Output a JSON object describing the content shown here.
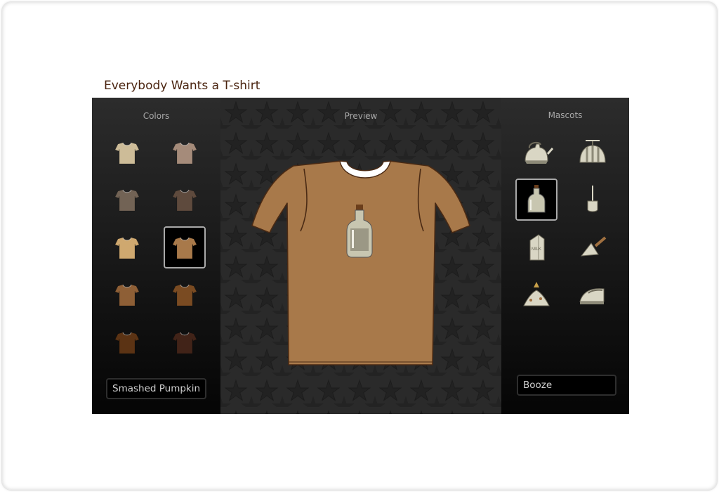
{
  "app": {
    "title": "Everybody Wants a T-shirt"
  },
  "colors_panel": {
    "heading": "Colors",
    "selected_name": "Smashed Pumpkin",
    "swatches": [
      {
        "color": "#cdbc98",
        "selected": false
      },
      {
        "color": "#a58b7a",
        "selected": false
      },
      {
        "color": "#726355",
        "selected": false
      },
      {
        "color": "#5e4a3d",
        "selected": false
      },
      {
        "color": "#cfa86f",
        "selected": false
      },
      {
        "color": "#a8794a",
        "selected": true
      },
      {
        "color": "#8e5f36",
        "selected": false
      },
      {
        "color": "#7a4b22",
        "selected": false
      },
      {
        "color": "#5b3314",
        "selected": false
      },
      {
        "color": "#412318",
        "selected": false
      }
    ]
  },
  "preview_panel": {
    "heading": "Preview",
    "shirt_color": "#a8794a",
    "collar_color": "#ffffff",
    "mascot": "bottle-icon"
  },
  "mascots_panel": {
    "heading": "Mascots",
    "selected_name": "Booze",
    "items": [
      {
        "icon": "kettle-icon",
        "selected": false
      },
      {
        "icon": "propeller-cap-icon",
        "selected": false
      },
      {
        "icon": "bottle-icon",
        "selected": true
      },
      {
        "icon": "shovel-icon",
        "selected": false
      },
      {
        "icon": "milk-carton-icon",
        "selected": false
      },
      {
        "icon": "trowel-icon",
        "selected": false
      },
      {
        "icon": "volcano-icon",
        "selected": false
      },
      {
        "icon": "iron-icon",
        "selected": false
      }
    ]
  }
}
